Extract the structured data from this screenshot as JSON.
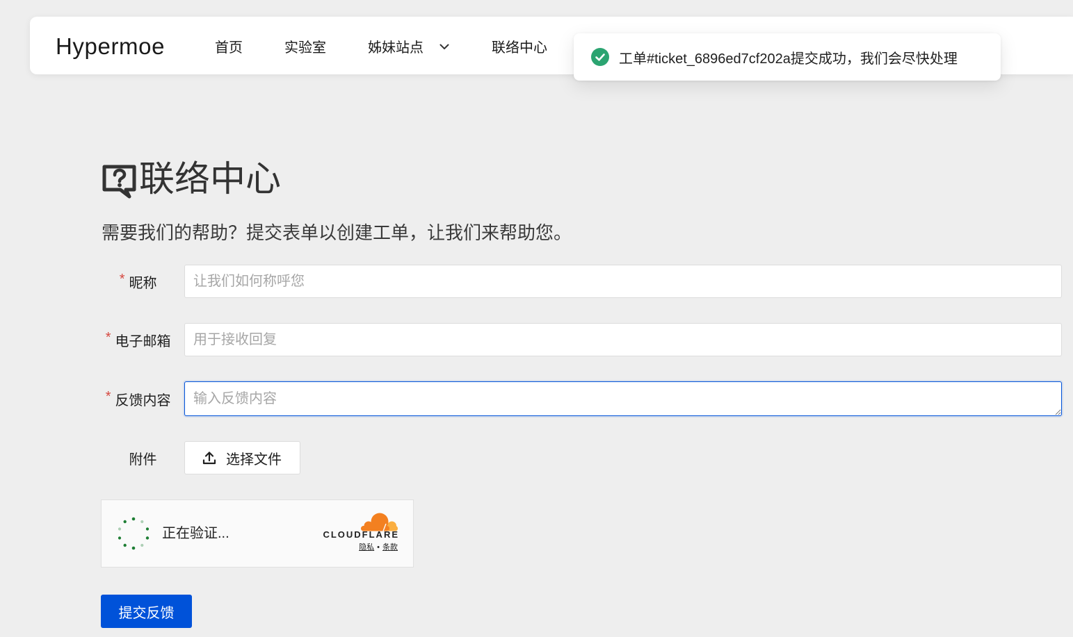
{
  "navbar": {
    "logo": "Hypermoe",
    "items": [
      {
        "label": "首页"
      },
      {
        "label": "实验室"
      },
      {
        "label": "姊妹站点",
        "icon": "chevron-down-icon"
      },
      {
        "label": "联络中心"
      }
    ]
  },
  "toast": {
    "icon": "check-circle-icon",
    "message": "工单#ticket_6896ed7cf202a提交成功，我们会尽快处理"
  },
  "page": {
    "icon": "comment-question-icon",
    "title": "联络中心",
    "subtitle": "需要我们的帮助？提交表单以创建工单，让我们来帮助您。"
  },
  "form": {
    "required_marker": "*",
    "fields": [
      {
        "label": "昵称",
        "required": true,
        "placeholder": "让我们如何称呼您",
        "value": ""
      },
      {
        "label": "电子邮箱",
        "required": true,
        "placeholder": "用于接收回复",
        "value": ""
      },
      {
        "label": "反馈内容",
        "required": true,
        "placeholder": "输入反馈内容",
        "value": "",
        "focused": true
      }
    ],
    "attachment": {
      "label": "附件",
      "button_label": "选择文件",
      "icon": "upload-icon"
    },
    "captcha": {
      "icon": "spinner-icon",
      "status": "正在验证...",
      "logo_icon": "cloudflare-cloud-icon",
      "brand": "CLOUDFLARE",
      "privacy_link": "隐私",
      "separator": "•",
      "terms_link": "条款"
    },
    "submit_label": "提交反馈"
  },
  "colors": {
    "background": "#eeeeee",
    "brand": "#0052d9",
    "success": "#2ba471",
    "required": "#d54941",
    "cloudflare_orange": "#f38020",
    "cloudflare_light_orange": "#faae40",
    "spinner": "#1e7e34"
  }
}
